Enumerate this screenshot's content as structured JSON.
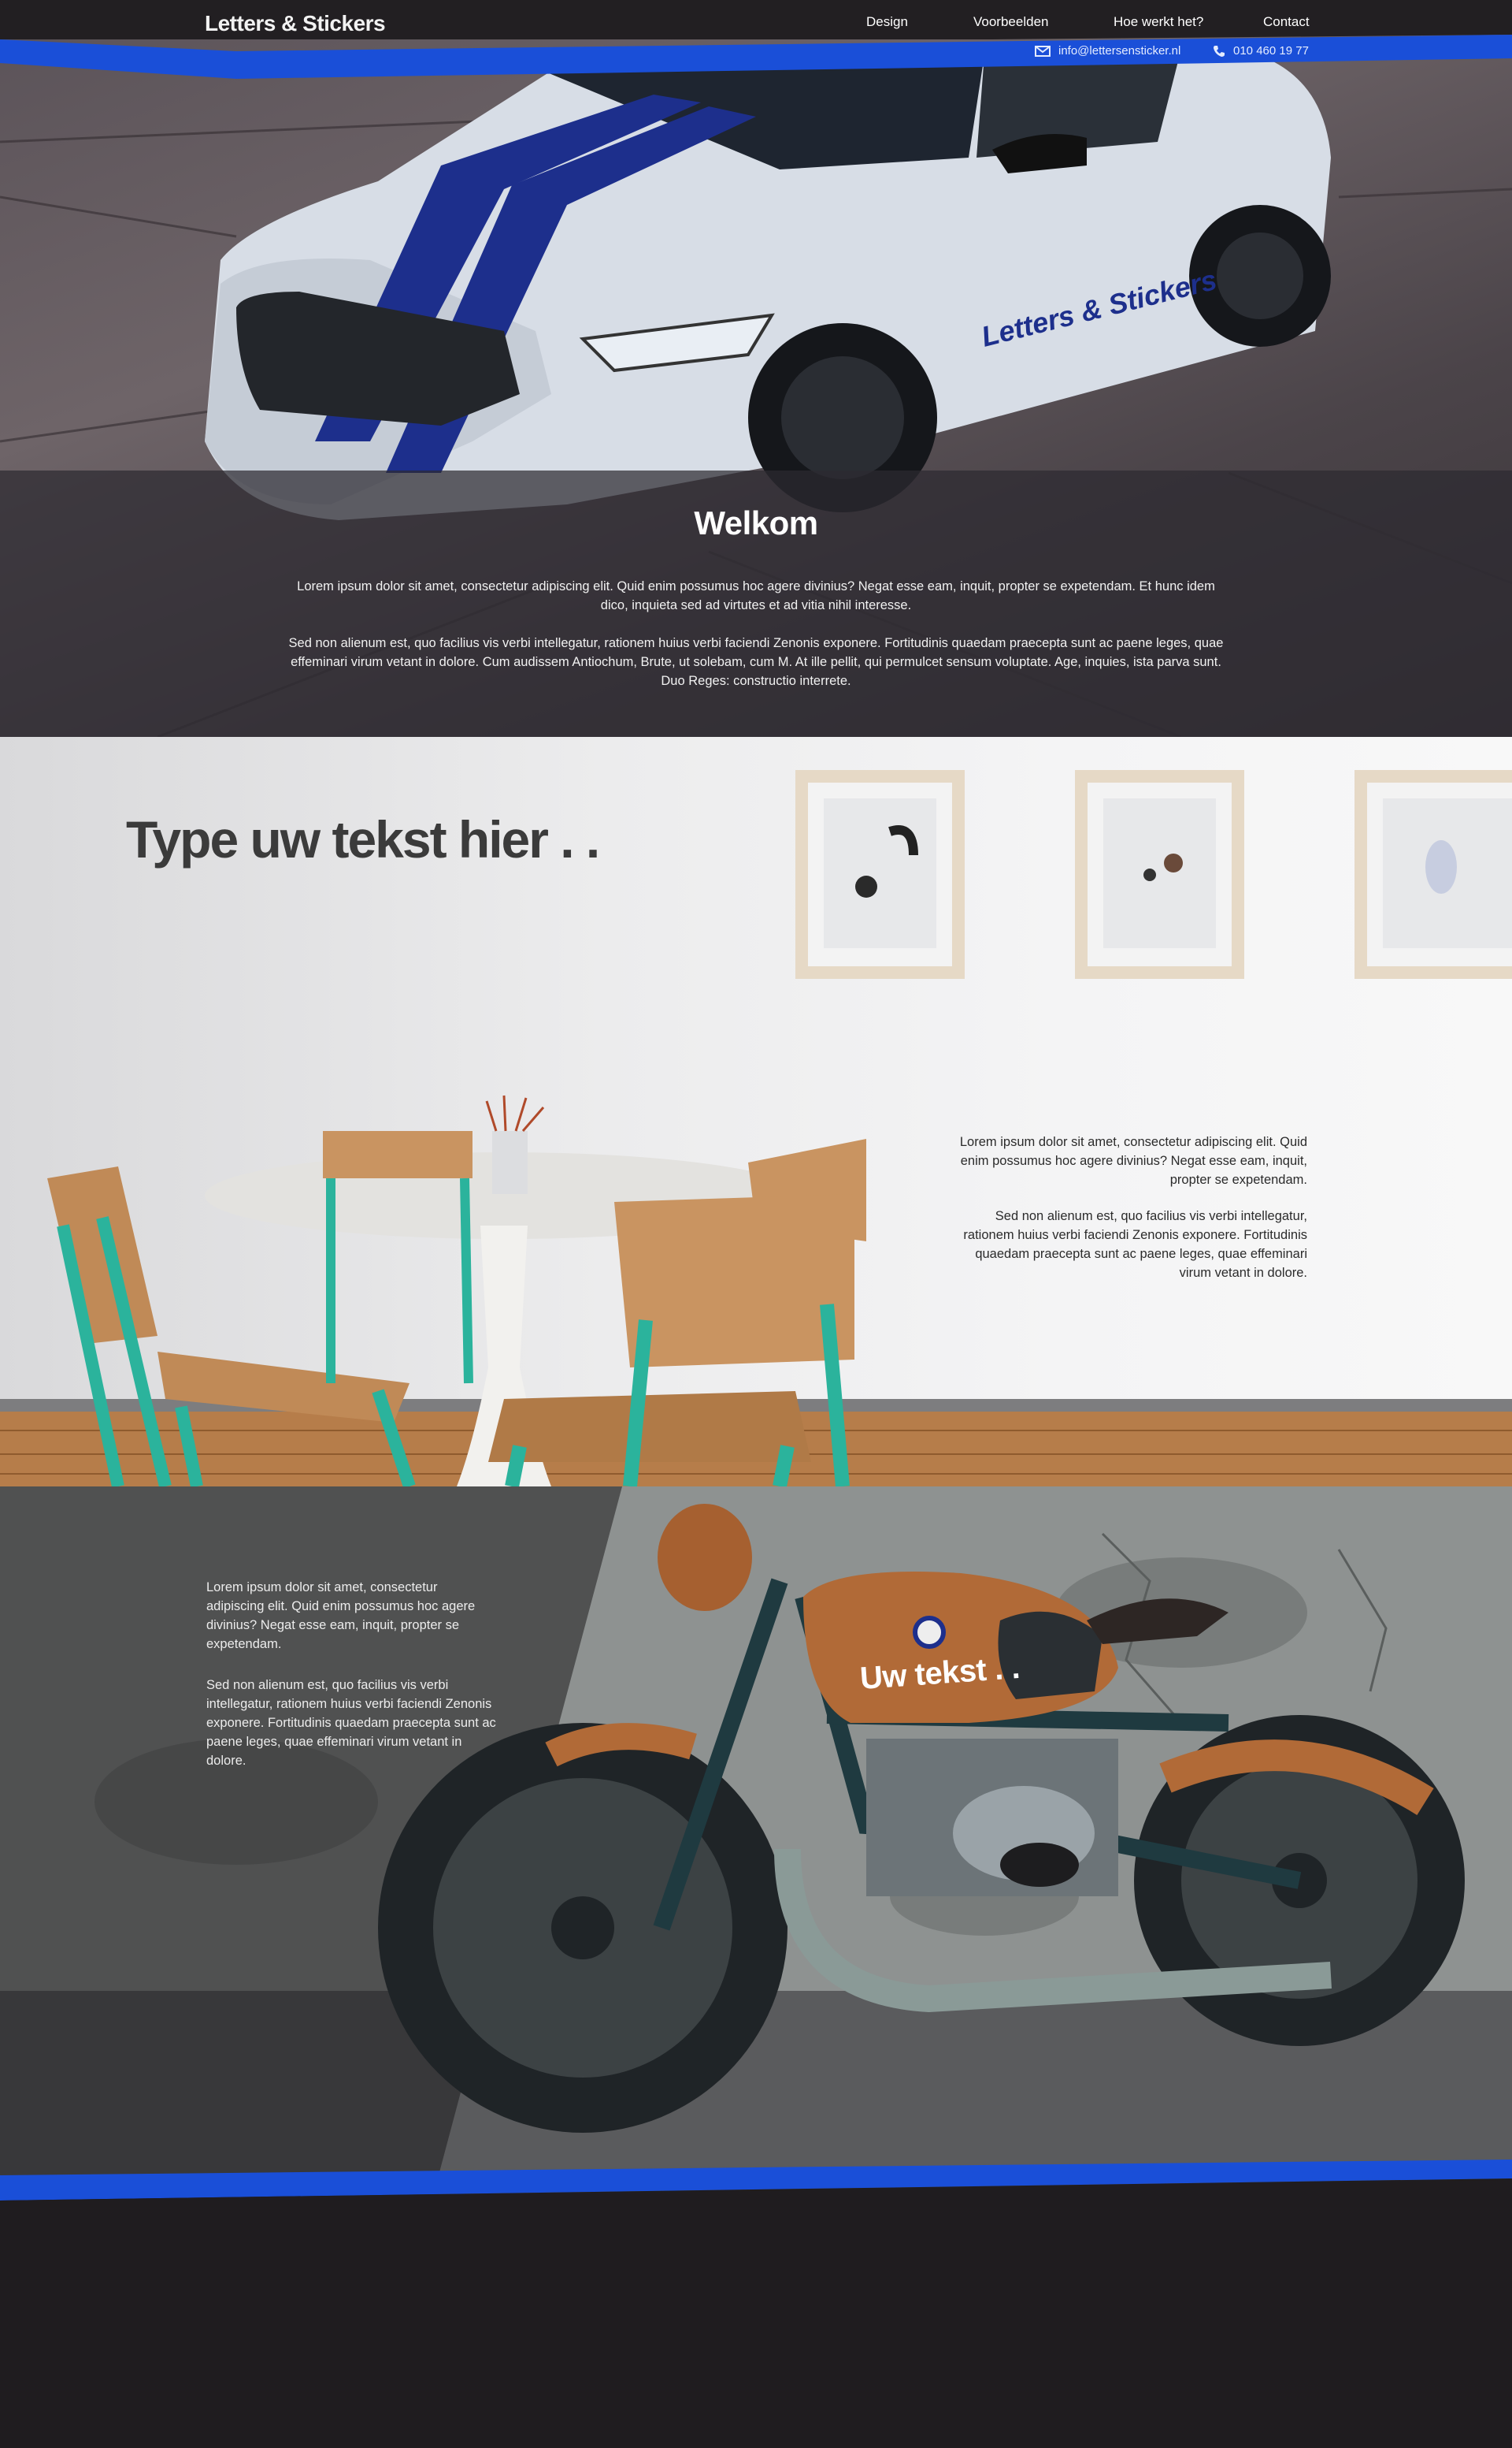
{
  "header": {
    "logo": "Letters & Stickers",
    "nav": [
      {
        "label": "Design"
      },
      {
        "label": "Voorbeelden"
      },
      {
        "label": "Hoe werkt het?"
      },
      {
        "label": "Contact"
      }
    ],
    "email": "info@lettersensticker.nl",
    "phone": "010 460 19 77",
    "accent_color": "#1a4fd8"
  },
  "hero": {
    "car_lettering": "Letters & Stickers",
    "title": "Welkom",
    "paragraphs": [
      "Lorem ipsum dolor sit amet, consectetur adipiscing elit. Quid enim possumus hoc agere divinius? Negat esse eam, inquit, propter se expetendam. Et hunc idem dico, inquieta sed ad virtutes et ad vitia nihil interesse.",
      "Sed non alienum est, quo facilius vis verbi intellegatur, rationem huius verbi faciendi Zenonis exponere. Fortitudinis quaedam praecepta sunt ac paene leges, quae effeminari virum vetant in dolore. Cum audissem Antiochum, Brute, ut solebam, cum M. At ille pellit, qui permulcet sensum voluptate. Age, inquies, ista parva sunt. Duo Reges: constructio interrete."
    ]
  },
  "room": {
    "heading": "Type uw tekst hier . .",
    "paragraphs": [
      "Lorem ipsum dolor sit amet, consectetur adipiscing elit. Quid enim possumus hoc agere divinius? Negat esse eam, inquit, propter se expetendam.",
      "Sed non alienum est, quo facilius vis verbi intellegatur, rationem huius verbi faciendi Zenonis exponere. Fortitudinis quaedam praecepta sunt ac paene leges, quae effeminari virum vetant in dolore."
    ]
  },
  "moto": {
    "tank_text": "Uw tekst . .",
    "paragraphs": [
      "Lorem ipsum dolor sit amet, consectetur adipiscing elit. Quid enim possumus hoc agere divinius? Negat esse eam, inquit, propter se expetendam.",
      "Sed non alienum est, quo facilius vis verbi intellegatur, rationem huius verbi faciendi Zenonis exponere. Fortitudinis quaedam praecepta sunt ac paene leges, quae effeminari virum vetant in dolore."
    ]
  }
}
